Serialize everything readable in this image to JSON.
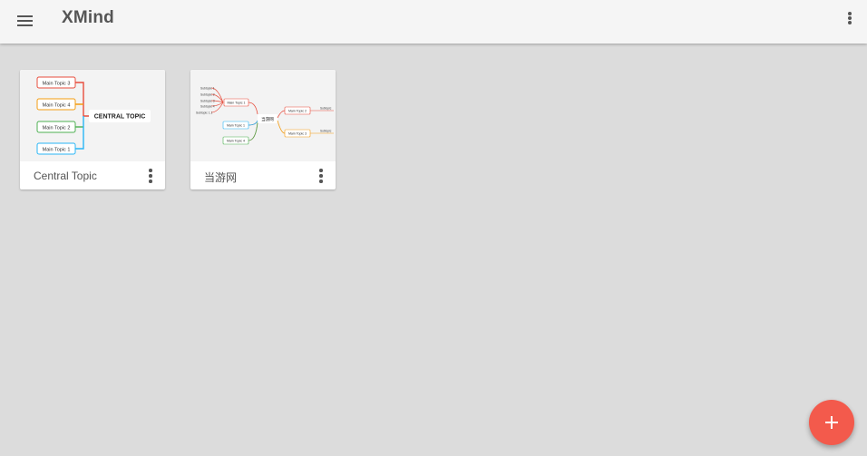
{
  "app": {
    "title": "XMind"
  },
  "cards": [
    {
      "title": "Central Topic",
      "thumbnail": {
        "central": "CENTRAL TOPIC",
        "topics": [
          "Main Topic 3",
          "Main Topic 4",
          "Main Topic 2",
          "Main Topic 1"
        ]
      }
    },
    {
      "title": "当游网",
      "thumbnail": {
        "central": "当游网",
        "left_topics": [
          "Main Topic 1",
          "Main Topic 1",
          "Main Topic 4"
        ],
        "right_topics": [
          "Main Topic 2",
          "Main Topic 3"
        ],
        "subtopics": [
          "Subtopic 1",
          "Subtopic 2",
          "Subtopic 3",
          "Subtopic 4"
        ],
        "floating": "Subtopic 1.1",
        "right_subs": [
          "Subtopic",
          "Subtopic"
        ]
      }
    }
  ],
  "icons": {
    "menu": "menu-icon",
    "overflow": "more-vert-icon",
    "card_menu": "more-vert-icon",
    "fab": "add-icon"
  },
  "colors": {
    "fab": "#f35a4c",
    "appbar": "#f5f5f5",
    "background": "#dcdcdc",
    "topic_red": "#e74c3c",
    "topic_orange": "#f39c12",
    "topic_green": "#4caf50",
    "topic_blue": "#29b6f6"
  }
}
